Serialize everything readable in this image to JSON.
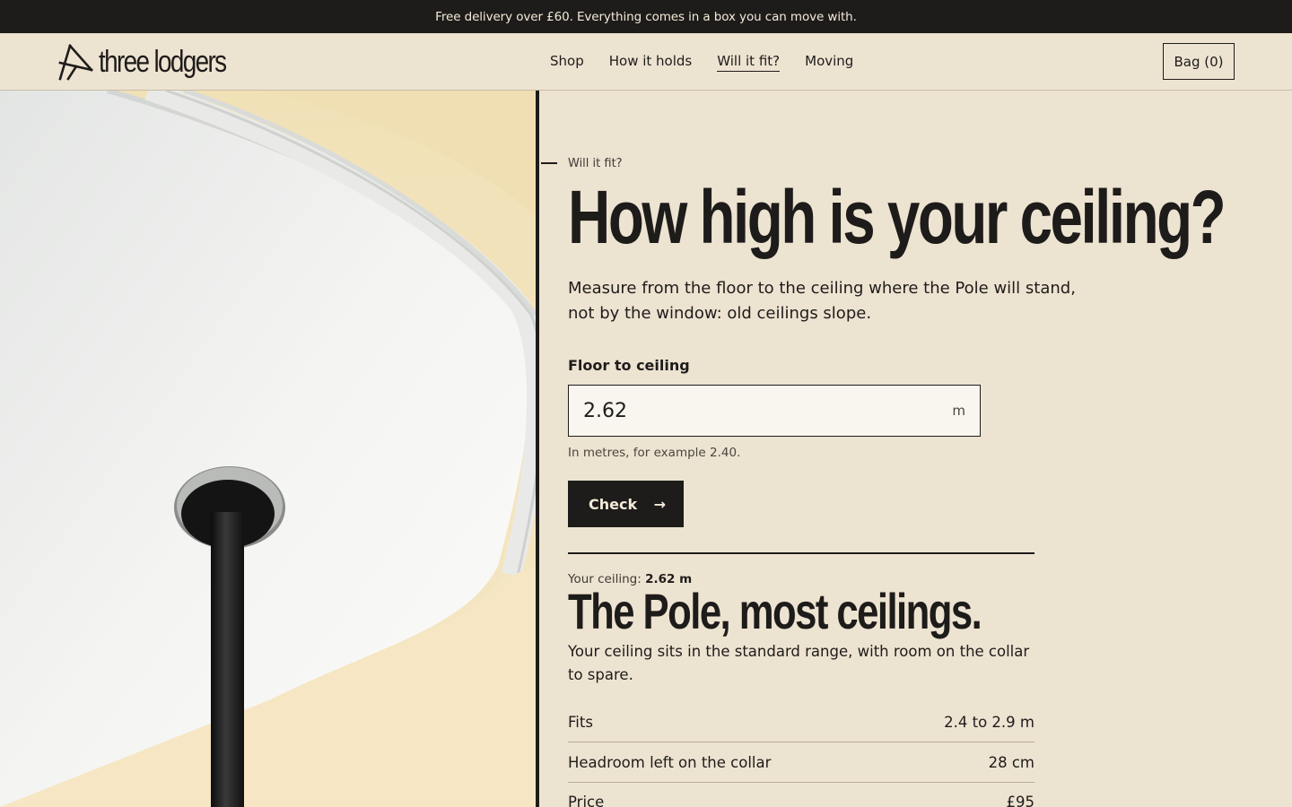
{
  "announcement": "Free delivery over £60. Everything comes in a box you can move with.",
  "brand": {
    "name": "three lodgers"
  },
  "nav": [
    {
      "label": "Shop",
      "active": false
    },
    {
      "label": "How it holds",
      "active": false
    },
    {
      "label": "Will it fit?",
      "active": true
    },
    {
      "label": "Moving",
      "active": false
    }
  ],
  "bag_label": "Bag (0)",
  "hero": {
    "eyebrow": "Will it fit?",
    "title": "How high is your ceiling?",
    "lead": "Measure from the floor to the ceiling where the Pole will stand, not by the window: old ceilings slope."
  },
  "form": {
    "label": "Floor to ceiling",
    "value": "2.62",
    "unit": "m",
    "hint": "In metres, for example 2.40.",
    "button_label": "Check",
    "button_icon": "→"
  },
  "result": {
    "ceiling_prefix": "Your ceiling:",
    "ceiling_value": "2.62 m",
    "title": "The Pole, most ceilings.",
    "text": "Your ceiling sits in the standard range, with room on the collar to spare.",
    "rows": [
      {
        "label": "Fits",
        "value": "2.4 to 2.9 m"
      },
      {
        "label": "Headroom left on the collar",
        "value": "28 cm"
      },
      {
        "label": "Price",
        "value": "£95"
      }
    ]
  },
  "colors": {
    "ink": "#1e1c1a",
    "paper": "#ede3d1",
    "field": "#f9f6ef"
  },
  "icons": {
    "logo": "tripod-logo-icon",
    "arrow": "arrow-right-icon"
  }
}
